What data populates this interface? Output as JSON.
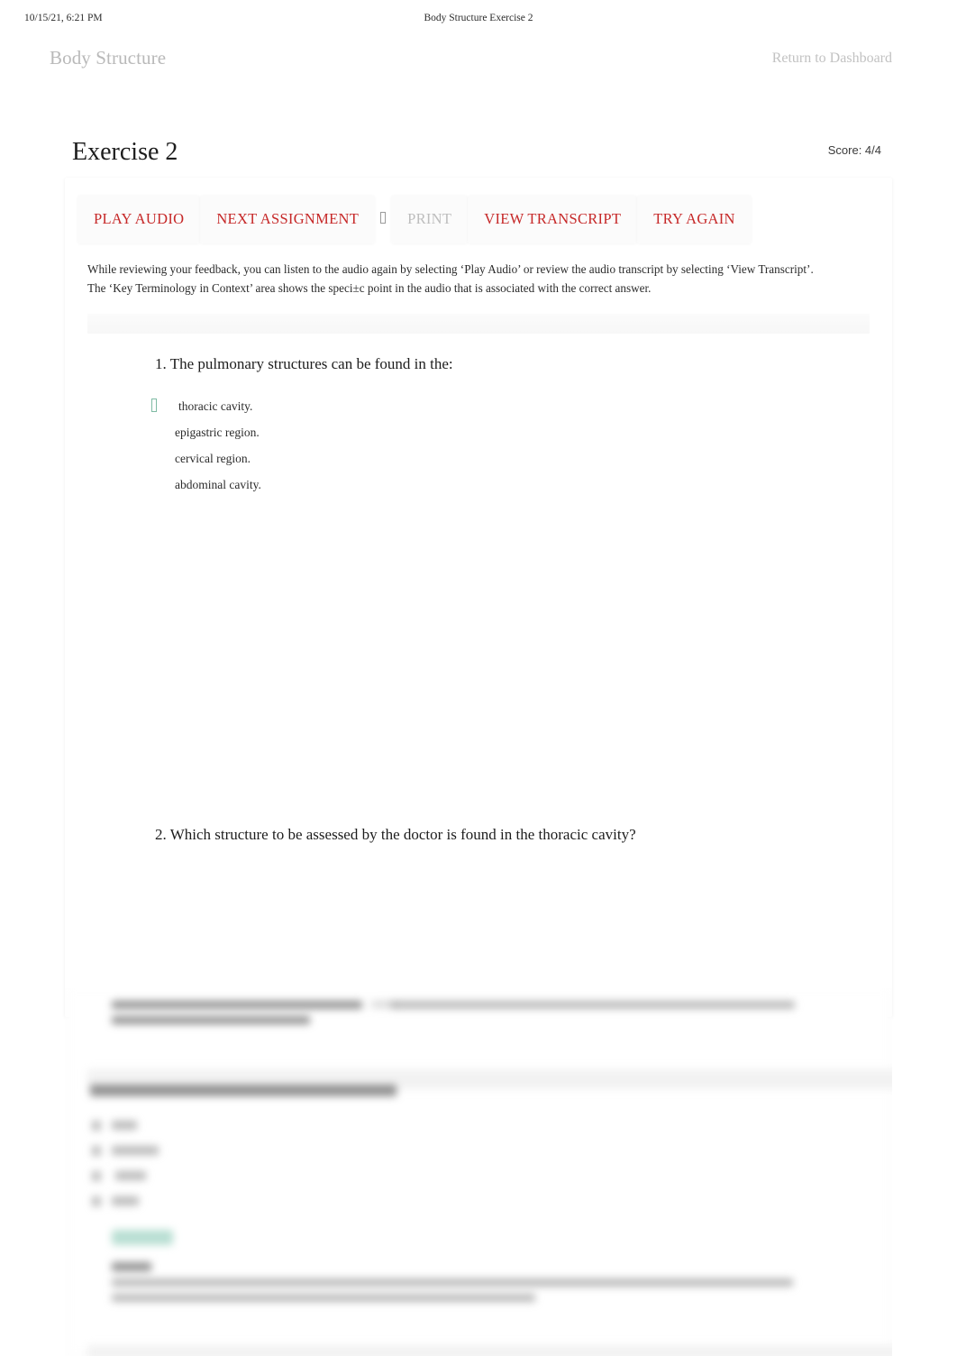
{
  "print_header": {
    "timestamp": "10/15/21, 6:21 PM",
    "document_title": "Body Structure Exercise 2"
  },
  "nav": {
    "brand": "Body Structure",
    "dashboard_link": "Return to Dashboard"
  },
  "page": {
    "title": "Exercise 2",
    "score_label": "Score: 4/4"
  },
  "toolbar": {
    "play_audio": "PLAY AUDIO",
    "next_assignment": "NEXT ASSIGNMENT",
    "separator_glyph": "missing-glyph-box",
    "print": "PRINT",
    "view_transcript": "VIEW TRANSCRIPT",
    "try_again": "TRY AGAIN",
    "accent_color": "#c62828",
    "disabled_color": "#bdbdbd"
  },
  "intro": {
    "line1": "While reviewing your feedback, you can listen to the audio again by selecting ‘Play Audio’ or review the audio transcript by selecting ‘View Transcript’.",
    "line2": "The ‘Key Terminology in Context’ area shows the speci±c point in the audio that is associated with the correct answer."
  },
  "questions": [
    {
      "number": "1.",
      "text": "1. The pulmonary structures can be found in the:",
      "options": [
        {
          "label": "thoracic cavity.",
          "marker": "correct-marker-glyph",
          "correct": true
        },
        {
          "label": "epigastric region.",
          "marker": "",
          "correct": false
        },
        {
          "label": "cervical region.",
          "marker": "",
          "correct": false
        },
        {
          "label": "abdominal cavity.",
          "marker": "",
          "correct": false
        }
      ]
    },
    {
      "number": "2.",
      "text": "2. Which structure to be assessed by the doctor is found in the thoracic cavity?",
      "options": []
    }
  ],
  "lower_section": {
    "state": "blurred",
    "note": "Out-of-focus continuation of the feedback page (illegible in screenshot)",
    "badge_color": "#9ed3c2"
  }
}
